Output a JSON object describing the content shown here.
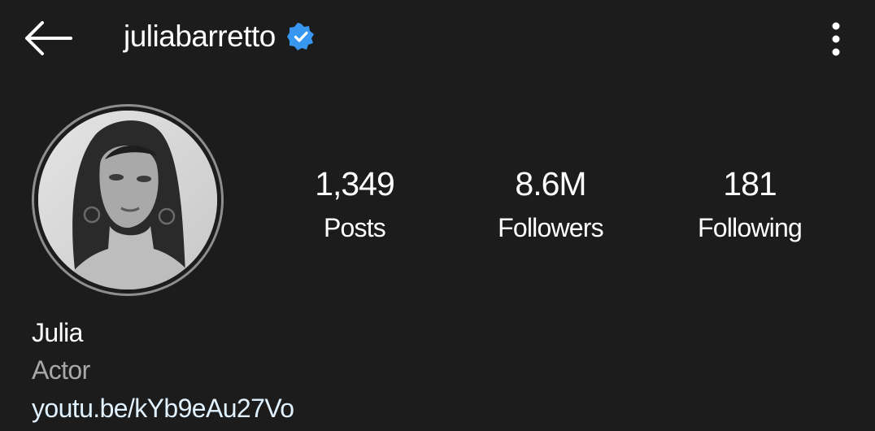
{
  "header": {
    "back_icon": "arrow-left-icon",
    "username": "juliabarretto",
    "verified_icon": "verified-badge-icon",
    "verified_color": "#3897f0",
    "more_icon": "more-vertical-icon"
  },
  "profile": {
    "avatar_icon": "profile-photo",
    "stats": [
      {
        "value": "1,349",
        "label": "Posts"
      },
      {
        "value": "8.6M",
        "label": "Followers"
      },
      {
        "value": "181",
        "label": "Following"
      }
    ]
  },
  "bio": {
    "name": "Julia",
    "category": "Actor",
    "link": "youtu.be/kYb9eAu27Vo",
    "link_color": "#e0f1ff"
  }
}
